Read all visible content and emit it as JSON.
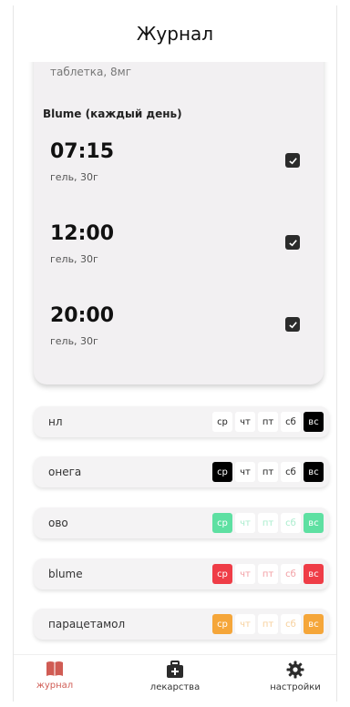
{
  "header": {
    "title": "Журнал"
  },
  "card": {
    "cut_text": "таблетка, 8мг",
    "medicine_title": "Blume (каждый день)",
    "doses": [
      {
        "time": "07:15",
        "sub": "гель, 30г",
        "checked": true
      },
      {
        "time": "12:00",
        "sub": "гель, 30г",
        "checked": true
      },
      {
        "time": "20:00",
        "sub": "гель, 30г",
        "checked": true
      }
    ]
  },
  "rows": [
    {
      "name": "нл",
      "days": [
        "ср",
        "чт",
        "пт",
        "сб",
        "вс"
      ],
      "styles": [
        "w",
        "w",
        "w",
        "w",
        "blk"
      ]
    },
    {
      "name": "онега",
      "days": [
        "ср",
        "чт",
        "пт",
        "сб",
        "вс"
      ],
      "styles": [
        "blk",
        "w",
        "w",
        "w",
        "blk"
      ]
    },
    {
      "name": "ово",
      "days": [
        "ср",
        "чт",
        "пт",
        "сб",
        "вс"
      ],
      "styles": [
        "grn",
        "grn-lt",
        "grn-lt",
        "grn-lt",
        "grn"
      ]
    },
    {
      "name": "blume",
      "days": [
        "ср",
        "чт",
        "пт",
        "сб",
        "вс"
      ],
      "styles": [
        "red",
        "red-lt",
        "red-lt",
        "red-lt",
        "red"
      ]
    },
    {
      "name": "парацетамол",
      "days": [
        "ср",
        "чт",
        "пт",
        "сб",
        "вс"
      ],
      "styles": [
        "org",
        "org-lt",
        "org-lt",
        "org-lt",
        "org"
      ]
    }
  ],
  "nav": {
    "items": [
      {
        "label": "журнал",
        "icon": "book-icon",
        "active": true
      },
      {
        "label": "лекарства",
        "icon": "medkit-icon",
        "active": false
      },
      {
        "label": "настройки",
        "icon": "gear-icon",
        "active": false
      }
    ]
  },
  "colors": {
    "accent": "#d05c54",
    "green": "#5ee0a2",
    "red": "#ef3d47",
    "orange": "#f5a63a"
  }
}
